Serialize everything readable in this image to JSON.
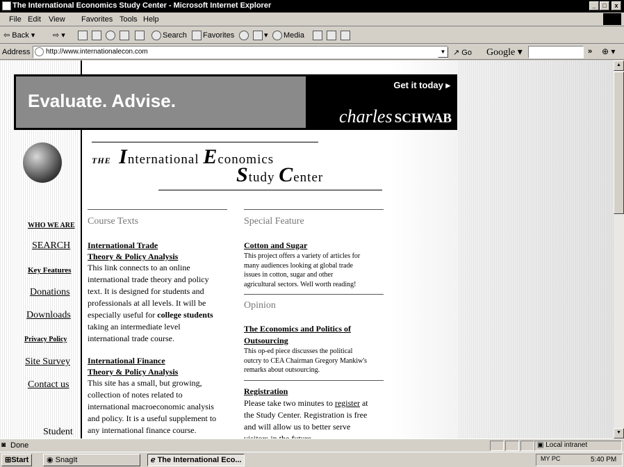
{
  "window": {
    "title": "The International Economics Study Center - Microsoft Internet Explorer",
    "minimize": "_",
    "maximize": "□",
    "close": "x"
  },
  "menu": [
    "File",
    "Edit",
    "View",
    "Favorites",
    "Tools",
    "Help"
  ],
  "toolbar": {
    "back": "Back",
    "search": "Search",
    "favorites": "Favorites",
    "media": "Media"
  },
  "address": {
    "label": "Address",
    "url": "http://www.internationalecon.com",
    "go": "Go",
    "google": "Google",
    "google_dd": "▾",
    "chevron": "»"
  },
  "ad": {
    "headline": "Evaluate. Advise.",
    "cta": "Get it today ▸",
    "brand_script": "charles",
    "brand_caps": "SCHWAB"
  },
  "masthead": {
    "the": "THE",
    "w1_big": "I",
    "w1_rest": "nternational",
    "w2_big": "E",
    "w2_rest": "conomics",
    "w3_big": "S",
    "w3_rest": "tudy",
    "w4_big": "C",
    "w4_rest": "enter"
  },
  "nav": {
    "who": "WHO WE ARE",
    "search": "SEARCH",
    "features": "Key Features",
    "donations": "Donations",
    "downloads": "Downloads",
    "privacy": "Privacy Policy",
    "survey": "Site Survey",
    "contact": "Contact us",
    "student": "Student"
  },
  "col1": {
    "heading": "Course Texts",
    "trade_link1": "International Trade",
    "trade_link2": "Theory & Policy Analysis",
    "trade_l1": "This link connects to an online",
    "trade_l2": "international trade theory and policy",
    "trade_l3": "text. It is designed for students and",
    "trade_l4": "professionals at all levels. It will be",
    "trade_l5a": "especially useful for ",
    "trade_l5b": "college students",
    "trade_l6": "taking an intermediate level",
    "trade_l7": "international trade course.",
    "fin_link1": "International Finance",
    "fin_link2": "Theory & Policy Analysis",
    "fin_l1": "This site has a small, but growing,",
    "fin_l2": "collection of notes related to",
    "fin_l3": "international macroeconomic analysis",
    "fin_l4": "and policy. It is a useful supplement to",
    "fin_l5": "any international finance course."
  },
  "col2": {
    "heading": "Special Feature",
    "cotton_link": "Cotton and Sugar",
    "cotton_l1": "This project offers a variety of articles for",
    "cotton_l2": "many audiences looking at global trade",
    "cotton_l3": "issues in cotton, sugar and other",
    "cotton_l4": "agricultural sectors. Well worth reading!",
    "opinion_heading": "Opinion",
    "out_link1": "The Economics and Politics of",
    "out_link2": "Outsourcing",
    "out_l1": "This op-ed piece discusses the political",
    "out_l2": "outcry to CEA Chairman Gregory Mankiw's",
    "out_l3": "remarks about outsourcing.",
    "reg_link": "Registration",
    "reg_l1a": "Please take two minutes to ",
    "reg_l1b": "register",
    "reg_l1c": " at",
    "reg_l2": "the Study Center. Registration is free",
    "reg_l3": "and will allow us to better serve",
    "reg_l4": "visitors in the future."
  },
  "status": {
    "text": "Done",
    "zone": "Local intranet"
  },
  "taskbar": {
    "start": "Start",
    "snagit": "SnagIt",
    "ie": "The International Eco...",
    "tray_icons": "MY PC",
    "clock": "5:40 PM"
  }
}
